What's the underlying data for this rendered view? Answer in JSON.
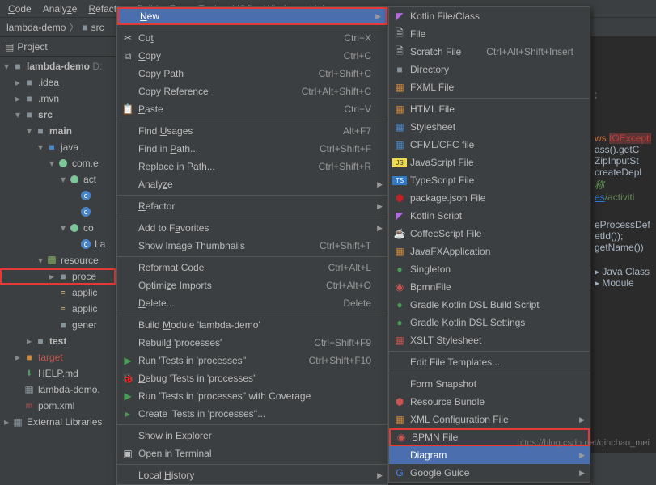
{
  "menubar": [
    "Code",
    "Analyze",
    "Refactor",
    "Build",
    "Run",
    "Tools",
    "VCS",
    "Window",
    "Help"
  ],
  "breadcrumb": {
    "root": "lambda-demo",
    "item": "src"
  },
  "sidebar": {
    "title": "Project"
  },
  "tree": {
    "root": "lambda-demo",
    "rootSuffix": "D:",
    "idea": ".idea",
    "mvn": ".mvn",
    "src": "src",
    "main": "main",
    "java": "java",
    "pkg": "com.e",
    "act": "act",
    "co": "co",
    "la": "La",
    "resource": "resource",
    "proce": "proce",
    "applic1": "applic",
    "applic2": "applic",
    "gener": "gener",
    "test": "test",
    "target": "target",
    "help": "HELP.md",
    "iml": "lambda-demo.",
    "pom": "pom.xml",
    "extlib": "External Libraries"
  },
  "cm1": {
    "new": "New",
    "cut": "Cut",
    "cut_sc": "Ctrl+X",
    "copy": "Copy",
    "copy_sc": "Ctrl+C",
    "copypath": "Copy Path",
    "copypath_sc": "Ctrl+Shift+C",
    "copyref": "Copy Reference",
    "copyref_sc": "Ctrl+Alt+Shift+C",
    "paste": "Paste",
    "paste_sc": "Ctrl+V",
    "findusages": "Find Usages",
    "findusages_sc": "Alt+F7",
    "findinpath": "Find in Path...",
    "findinpath_sc": "Ctrl+Shift+F",
    "replaceinpath": "Replace in Path...",
    "replaceinpath_sc": "Ctrl+Shift+R",
    "analyze": "Analyze",
    "refactor": "Refactor",
    "addfav": "Add to Favorites",
    "showthumb": "Show Image Thumbnails",
    "showthumb_sc": "Ctrl+Shift+T",
    "reformat": "Reformat Code",
    "reformat_sc": "Ctrl+Alt+L",
    "optimize": "Optimize Imports",
    "optimize_sc": "Ctrl+Alt+O",
    "delete": "Delete...",
    "delete_sc": "Delete",
    "build": "Build Module 'lambda-demo'",
    "rebuild": "Rebuild 'processes'",
    "rebuild_sc": "Ctrl+Shift+F9",
    "runtests": "Run 'Tests in 'processes''",
    "runtests_sc": "Ctrl+Shift+F10",
    "debugtests": "Debug 'Tests in 'processes''",
    "runcov": "Run 'Tests in 'processes'' with Coverage",
    "createtests": "Create 'Tests in 'processes''...",
    "showexp": "Show in Explorer",
    "openterm": "Open in Terminal",
    "localhist": "Local History"
  },
  "cm2": {
    "kotlin": "Kotlin File/Class",
    "file": "File",
    "scratch": "Scratch File",
    "scratch_sc": "Ctrl+Alt+Shift+Insert",
    "directory": "Directory",
    "fxml": "FXML File",
    "html": "HTML File",
    "stylesheet": "Stylesheet",
    "cfml": "CFML/CFC file",
    "js": "JavaScript File",
    "ts": "TypeScript File",
    "pkgjson": "package.json File",
    "kts": "Kotlin Script",
    "coffee": "CoffeeScript File",
    "jfx": "JavaFXApplication",
    "singleton": "Singleton",
    "bpmn": "BpmnFile",
    "gkbs": "Gradle Kotlin DSL Build Script",
    "gks": "Gradle Kotlin DSL Settings",
    "xslt": "XSLT Stylesheet",
    "editft": "Edit File Templates...",
    "formsnap": "Form Snapshot",
    "resbundle": "Resource Bundle",
    "xmlconf": "XML Configuration File",
    "bpmnfile": "BPMN File",
    "diagram": "Diagram",
    "guice": "Google Guice"
  },
  "editor": {
    "l1": ";",
    "l2": "ws",
    "l2b": "IOExcepti",
    "l3": "ass().getC",
    "l4": "ZipInputSt",
    "l5": "createDepl",
    "l6": "称",
    "l7": "es",
    "l7b": "/activiti",
    "l8": "eProcessDef",
    "l9": "etId());",
    "l10": "getName())",
    "l11a": "Java Class",
    "l12a": "Module"
  },
  "watermark": "https://blog.csdn.net/qinchao_mei"
}
